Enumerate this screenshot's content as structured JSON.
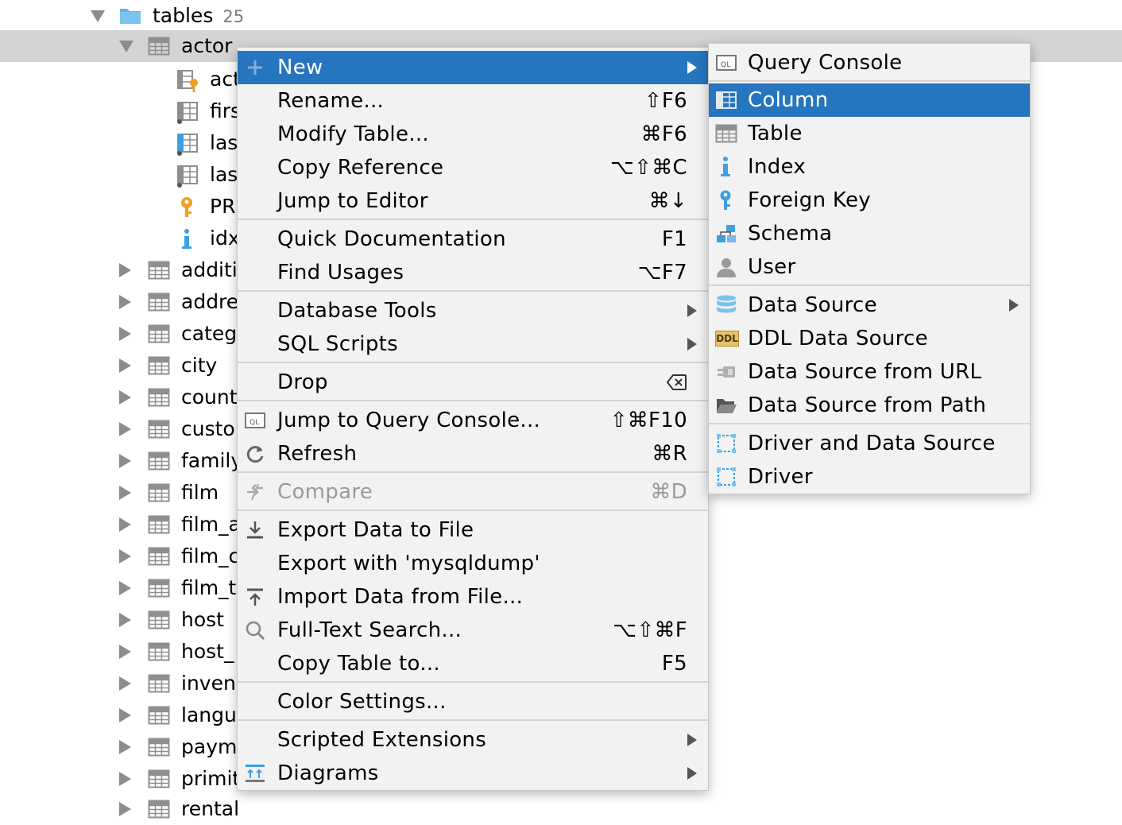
{
  "tree": {
    "folder": {
      "label": "tables",
      "count": "25"
    },
    "selected_table": "actor",
    "children": [
      "act",
      "firs",
      "las",
      "las",
      "PR",
      "idx"
    ],
    "tables": [
      "additi",
      "addre",
      "categ",
      "city",
      "count",
      "custo",
      "family",
      "film",
      "film_a",
      "film_c",
      "film_t",
      "host",
      "host_",
      "inven",
      "langu",
      "paym",
      "primit",
      "rental"
    ]
  },
  "main_menu": {
    "new": "New",
    "rename": "Rename...",
    "rename_sc": "⇧F6",
    "modify": "Modify Table...",
    "modify_sc": "⌘F6",
    "copyref": "Copy Reference",
    "copyref_sc": "⌥⇧⌘C",
    "jump_editor": "Jump to Editor",
    "jump_editor_sc": "⌘↓",
    "quickdoc": "Quick Documentation",
    "quickdoc_sc": "F1",
    "usages": "Find Usages",
    "usages_sc": "⌥F7",
    "dbtools": "Database Tools",
    "sqlscripts": "SQL Scripts",
    "drop": "Drop",
    "jumpconsole": "Jump to Query Console...",
    "jumpconsole_sc": "⇧⌘F10",
    "refresh": "Refresh",
    "refresh_sc": "⌘R",
    "compare": "Compare",
    "compare_sc": "⌘D",
    "export": "Export Data to File",
    "mysqldump": "Export with 'mysqldump'",
    "import": "Import Data from File...",
    "fulltext": "Full-Text Search...",
    "fulltext_sc": "⌥⇧⌘F",
    "copytable": "Copy Table to...",
    "copytable_sc": "F5",
    "color": "Color Settings...",
    "scripted": "Scripted Extensions",
    "diagrams": "Diagrams"
  },
  "sub_menu": {
    "query_console": "Query Console",
    "column": "Column",
    "table": "Table",
    "index": "Index",
    "foreign_key": "Foreign Key",
    "schema": "Schema",
    "user": "User",
    "data_source": "Data Source",
    "ddl_data_source": "DDL Data Source",
    "ddl_badge": "DDL",
    "ds_url": "Data Source from URL",
    "ds_path": "Data Source from Path",
    "driver_ds": "Driver and Data Source",
    "driver": "Driver"
  },
  "colors": {
    "highlight": "#2675bf",
    "menu_bg": "#f2f2f2",
    "selected_row": "#d4d4d4",
    "icon_blue": "#3d9fe0"
  }
}
